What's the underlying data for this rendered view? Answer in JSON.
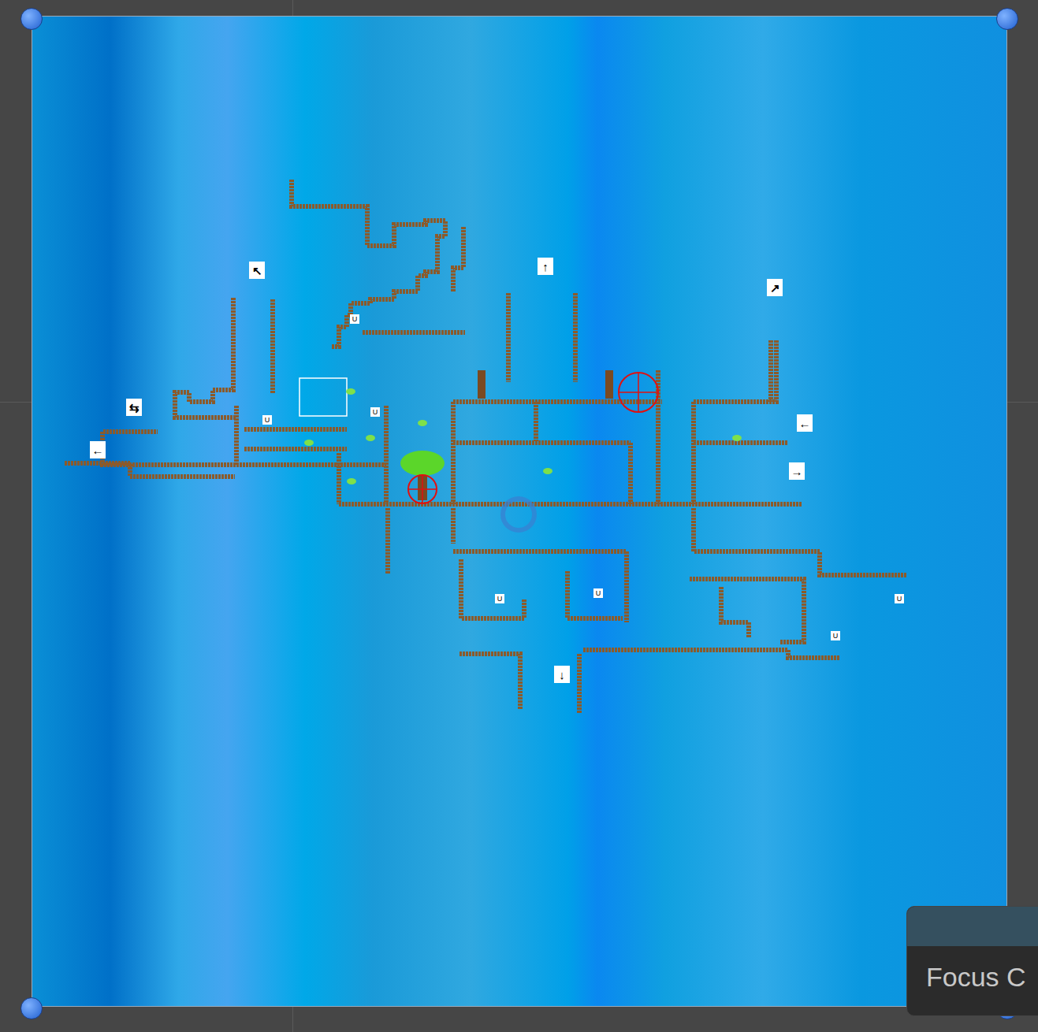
{
  "scene": {
    "signs": [
      {
        "text": "↖"
      },
      {
        "text": "↑"
      },
      {
        "text": "↗"
      },
      {
        "text": "←"
      },
      {
        "text": "→"
      },
      {
        "text": "↓"
      },
      {
        "text": "←"
      },
      {
        "text": "⇆"
      }
    ],
    "markers": [
      {
        "text": "U"
      },
      {
        "text": "U"
      },
      {
        "text": "U"
      },
      {
        "text": "U"
      },
      {
        "text": "U"
      },
      {
        "text": "U"
      },
      {
        "text": "U"
      }
    ]
  },
  "tooltip": {
    "text": "Focus C"
  }
}
